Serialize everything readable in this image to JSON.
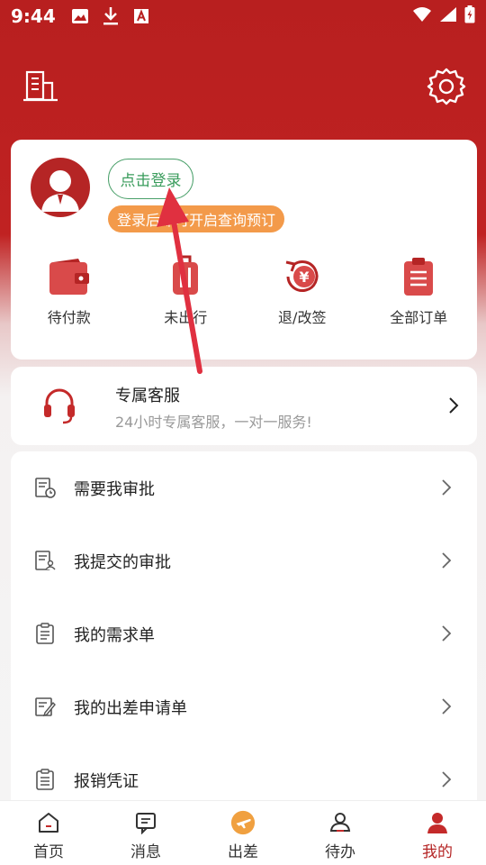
{
  "status_bar": {
    "time": "9:44",
    "icons": [
      "image-icon",
      "download-icon",
      "font-icon"
    ],
    "right_icons": [
      "wifi-icon",
      "signal-icon",
      "battery-icon"
    ]
  },
  "header": {
    "left_icon": "building-icon",
    "right_icon": "settings-icon"
  },
  "login_card": {
    "login_button": "点击登录",
    "login_tip": "登录后即可开启查询预订",
    "orders": [
      {
        "label": "待付款",
        "icon": "wallet-icon"
      },
      {
        "label": "未出行",
        "icon": "luggage-icon"
      },
      {
        "label": "退/改签",
        "icon": "refund-icon"
      },
      {
        "label": "全部订单",
        "icon": "clipboard-icon"
      }
    ]
  },
  "service": {
    "title": "专属客服",
    "subtitle": "24小时专属客服，一对一服务!",
    "icon": "headset-icon"
  },
  "menu": [
    {
      "label": "需要我审批",
      "icon": "approval-pending-icon"
    },
    {
      "label": "我提交的审批",
      "icon": "approval-submitted-icon"
    },
    {
      "label": "我的需求单",
      "icon": "requirement-icon"
    },
    {
      "label": "我的出差申请单",
      "icon": "trip-application-icon"
    },
    {
      "label": "报销凭证",
      "icon": "voucher-icon"
    }
  ],
  "tabbar": [
    {
      "label": "首页",
      "icon": "home-icon"
    },
    {
      "label": "消息",
      "icon": "message-icon"
    },
    {
      "label": "出差",
      "icon": "trip-icon"
    },
    {
      "label": "待办",
      "icon": "todo-icon"
    },
    {
      "label": "我的",
      "icon": "profile-icon",
      "active": true
    }
  ],
  "colors": {
    "brand_red": "#b81f1f",
    "login_green": "#3a9c5c",
    "tip_orange": "#f39a4a",
    "annotation_arrow": "#e03040"
  }
}
